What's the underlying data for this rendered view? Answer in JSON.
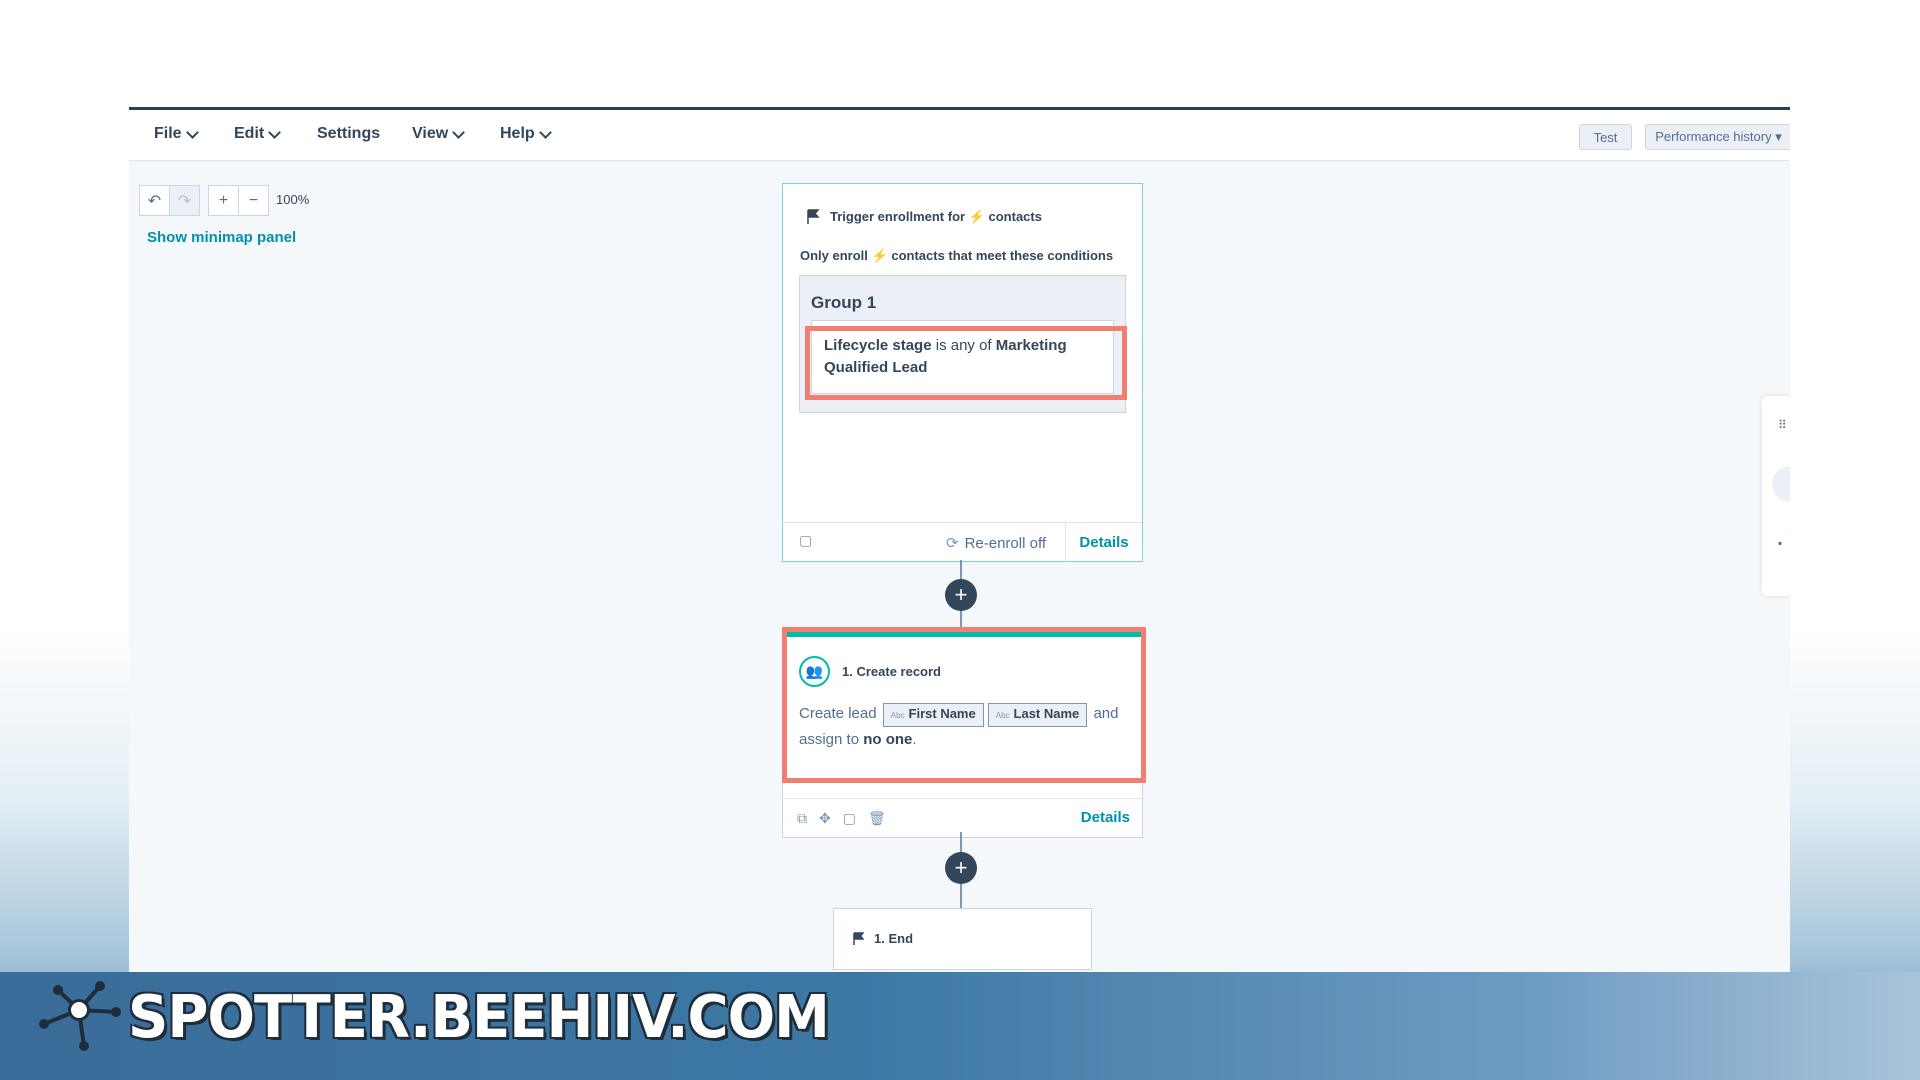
{
  "menu": {
    "file": "File",
    "edit": "Edit",
    "settings": "Settings",
    "view": "View",
    "help": "Help"
  },
  "toolbar": {
    "test": "Test",
    "performance_history": "Performance history ▾"
  },
  "canvas_controls": {
    "undo": "↶",
    "redo": "↷",
    "zoom_in": "+",
    "zoom_out": "−",
    "zoom_level": "100%",
    "minimap_link": "Show minimap panel"
  },
  "trigger": {
    "heading_prefix": "Trigger enrollment for",
    "bolt": "⚡",
    "heading_suffix": "contacts",
    "sub_prefix": "Only enroll",
    "sub_suffix": "contacts that meet these conditions",
    "group_title": "Group 1",
    "condition_property": "Lifecycle stage",
    "condition_operator": " is any of ",
    "condition_value": "Marketing Qualified Lead",
    "reenroll": "Re-enroll off",
    "details": "Details"
  },
  "action": {
    "title": "1. Create record",
    "text_create": "Create lead",
    "token1_type": "Abc",
    "token1": "First Name",
    "token2_type": "Abc",
    "token2": "Last Name",
    "text_and": "and",
    "text_assign": "assign to",
    "assignee": "no one",
    "period": ".",
    "details": "Details"
  },
  "end": {
    "label": "1. End"
  },
  "watermark": {
    "text": "SPOTTER.BEEHIIV.COM"
  },
  "colors": {
    "accent_teal": "#00bda5",
    "link_blue": "#0091ae",
    "highlight": "#f07f72",
    "dark_navy": "#33475b"
  }
}
